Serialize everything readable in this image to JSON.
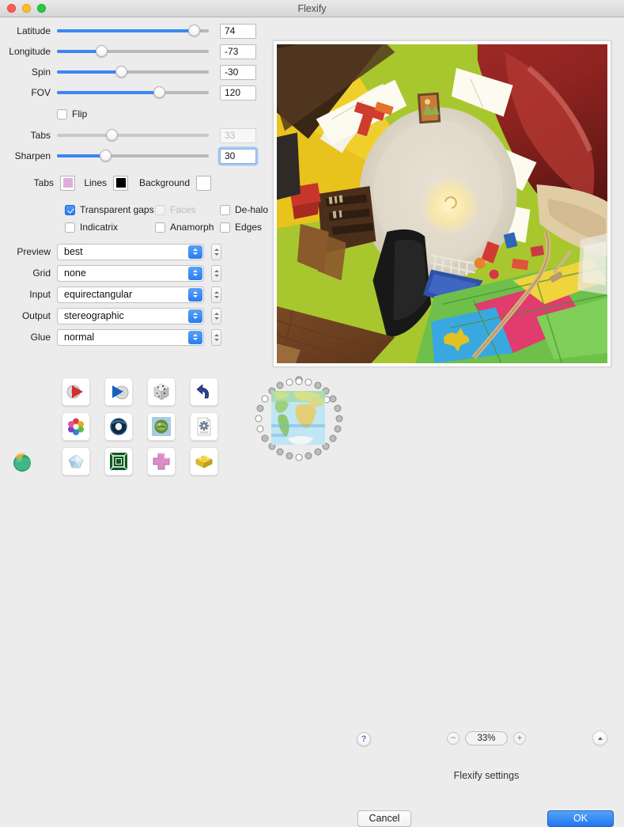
{
  "window": {
    "title": "Flexify",
    "traffic_lights": [
      "close",
      "minimize",
      "zoom"
    ]
  },
  "sliders": [
    {
      "label": "Latitude",
      "value": "74",
      "fill_pct": 90,
      "thumb_pct": 90,
      "enabled": true,
      "focused": false
    },
    {
      "label": "Longitude",
      "value": "-73",
      "fill_pct": 29,
      "thumb_pct": 29,
      "enabled": true,
      "focused": false
    },
    {
      "label": "Spin",
      "value": "-30",
      "fill_pct": 42,
      "thumb_pct": 42,
      "enabled": true,
      "focused": false
    },
    {
      "label": "FOV",
      "value": "120",
      "fill_pct": 67,
      "thumb_pct": 67,
      "enabled": true,
      "focused": false
    },
    {
      "label": "Tabs",
      "value": "33",
      "fill_pct": 0,
      "thumb_pct": 36,
      "enabled": false,
      "focused": false
    },
    {
      "label": "Sharpen",
      "value": "30",
      "fill_pct": 32,
      "thumb_pct": 32,
      "enabled": true,
      "focused": true
    }
  ],
  "flip_checkbox": {
    "label": "Flip",
    "checked": false,
    "enabled": true
  },
  "swatches": [
    {
      "label": "Tabs",
      "color": "#ddaedd"
    },
    {
      "label": "Lines",
      "color": "#000000"
    },
    {
      "label": "Background",
      "color": "#ffffff"
    }
  ],
  "checkboxes": [
    {
      "label": "Transparent gaps",
      "checked": true,
      "enabled": true
    },
    {
      "label": "Faces",
      "checked": false,
      "enabled": false
    },
    {
      "label": "De-halo",
      "checked": false,
      "enabled": true
    },
    {
      "label": "Indicatrix",
      "checked": false,
      "enabled": true
    },
    {
      "label": "Anamorph",
      "checked": false,
      "enabled": true
    },
    {
      "label": "Edges",
      "checked": false,
      "enabled": true
    }
  ],
  "selects": [
    {
      "label": "Preview",
      "value": "best"
    },
    {
      "label": "Grid",
      "value": "none"
    },
    {
      "label": "Input",
      "value": "equirectangular"
    },
    {
      "label": "Output",
      "value": "stereographic"
    },
    {
      "label": "Glue",
      "value": "normal"
    }
  ],
  "preset_icons": [
    {
      "name": "red-arrow-disc-icon"
    },
    {
      "name": "blue-arrow-disc-icon"
    },
    {
      "name": "dice-cube-icon"
    },
    {
      "name": "undo-arrow-icon"
    },
    {
      "name": "color-wheel-flower-icon"
    },
    {
      "name": "dark-torus-icon"
    },
    {
      "name": "globe-photo-icon"
    },
    {
      "name": "document-gear-icon"
    },
    {
      "name": "pentagon-crystal-icon"
    },
    {
      "name": "green-square-frame-icon"
    },
    {
      "name": "pink-cross-icon"
    },
    {
      "name": "yellow-brick-icon"
    }
  ],
  "map_thumbnail": {
    "name": "world-map-thumbnail",
    "dot_count": 28
  },
  "app_icon": {
    "name": "flexify-app-icon"
  },
  "help_button": {
    "label": "?"
  },
  "zoom_control": {
    "minus_label": "−",
    "value": "33%",
    "plus_label": "+"
  },
  "disclosure_button": {
    "name": "chevron-up-icon"
  },
  "settings_label": "Flexify settings",
  "buttons": {
    "cancel": "Cancel",
    "ok": "OK"
  },
  "colors": {
    "accent_blue": "#2a7cf0",
    "window_bg": "#ececec",
    "titlebar_bg": "#e0e0e0"
  }
}
